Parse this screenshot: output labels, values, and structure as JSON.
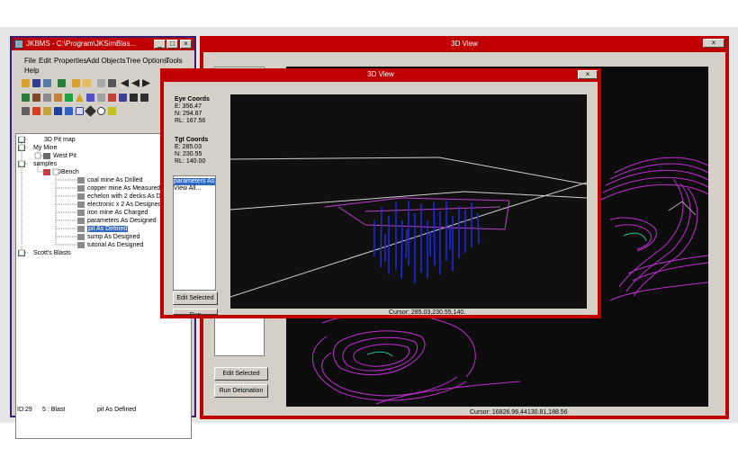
{
  "main_window": {
    "title": "JKBMS - C:\\Program\\JKSimBlas...",
    "menu": [
      "File",
      "Edit",
      "Properties",
      "Add Objects",
      "Tree Options",
      "Tools",
      "Help"
    ],
    "tree": [
      {
        "label": "3D Pit map"
      },
      {
        "label": "My Mine"
      },
      {
        "label": "West Pit"
      },
      {
        "label": "samples"
      },
      {
        "label": "2DBench"
      },
      {
        "label": "coal mine As Drilled"
      },
      {
        "label": "copper mine As Measured"
      },
      {
        "label": "echelon with 2 decks As Designed"
      },
      {
        "label": "electronic x 2 As Designed"
      },
      {
        "label": "iron mine As Charged"
      },
      {
        "label": "parameters As Designed"
      },
      {
        "label": "pit As Defined"
      },
      {
        "label": "sump As Designed"
      },
      {
        "label": "tutorial As Designed"
      },
      {
        "label": "Scott's Blasts"
      }
    ],
    "status": {
      "id": "ID:29",
      "type": "5 : Blast",
      "name": "pit As Defined"
    }
  },
  "big_view": {
    "title": "3D View",
    "buttons": {
      "edit": "Edit Selected",
      "run": "Run Detonation"
    },
    "cursor": "Cursor: 16826.96,44130.81,188.56"
  },
  "small_view": {
    "title": "3D View",
    "eye": {
      "heading": "Eye Coords",
      "e": "E: 356.47",
      "n": "N: 294.87",
      "rl": "RL: 167.56"
    },
    "tgt": {
      "heading": "Tgt Coords",
      "e": "E: 285.03",
      "n": "N: 230.55",
      "rl": "RL: 140.00"
    },
    "list": [
      "parameters As D",
      "View All..."
    ],
    "buttons": {
      "edit": "Edit Selected",
      "run": "Run Detonation"
    },
    "cursor": "Cursor: 285.03,230.55,140."
  },
  "colors": {
    "frame": "#c00000",
    "selection": "#316ac5",
    "holes": "#1a2adc",
    "contours": "#c030d0"
  },
  "icons": [
    "app-icon",
    "new-icon",
    "open-icon",
    "save-icon",
    "print-icon",
    "first-icon",
    "prev-icon",
    "next-icon",
    "last-icon",
    "mine-icon",
    "bench-icon",
    "blast-icon"
  ]
}
